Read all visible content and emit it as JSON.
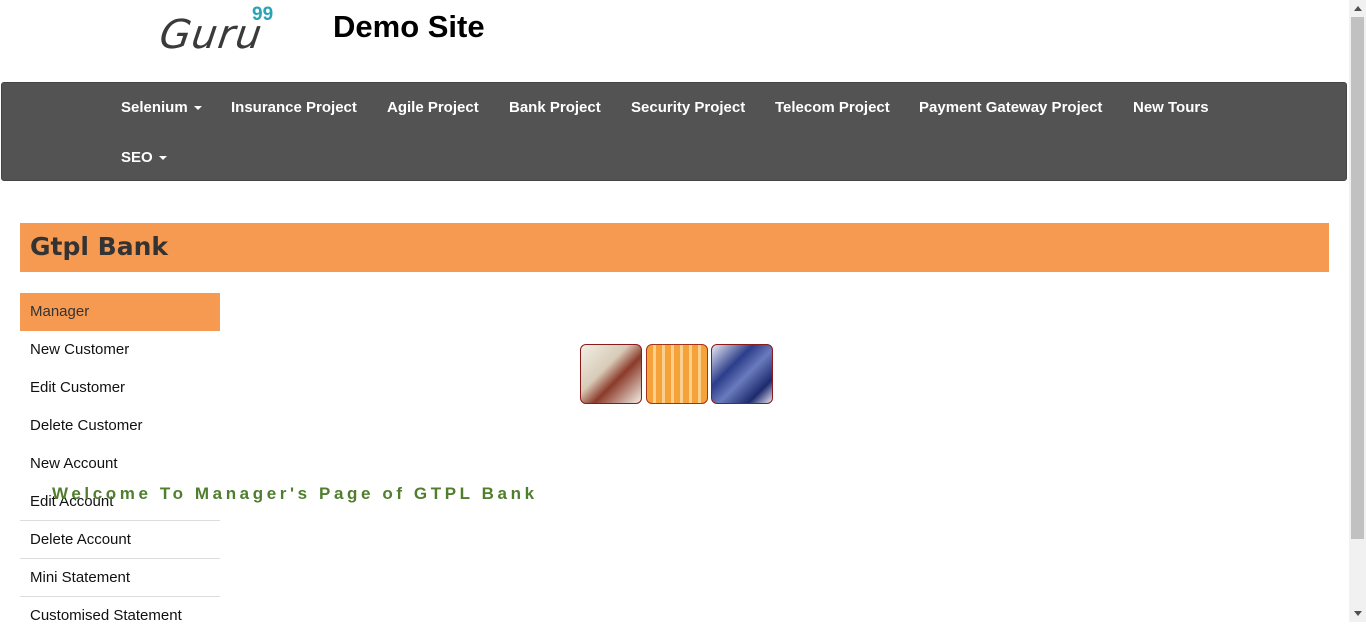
{
  "logo": {
    "text": "Guru",
    "sup": "99"
  },
  "site_title": "Demo Site",
  "nav": {
    "selenium": "Selenium",
    "insurance": "Insurance Project",
    "agile": "Agile Project",
    "bank": "Bank Project",
    "security": "Security Project",
    "telecom": "Telecom Project",
    "payment": "Payment Gateway Project",
    "tours": "New Tours",
    "seo": "SEO"
  },
  "bank": {
    "title": "Gtpl Bank"
  },
  "menu": {
    "items": [
      "Manager",
      "New Customer",
      "Edit Customer",
      "Delete Customer",
      "New Account",
      "Edit Account",
      "Delete Account",
      "Mini Statement",
      "Customised Statement"
    ],
    "active": "Manager"
  },
  "welcome": "Welcome To Manager's Page of GTPL Bank",
  "colors": {
    "nav_bg": "#535353",
    "accent_orange": "#f79a51",
    "welcome_green": "#4f7f2e",
    "logo_sup": "#2aa3b5"
  },
  "icons": {
    "dropdown": "caret-down-icon",
    "scroll_up": "scroll-up-arrow-icon",
    "scroll_down": "scroll-down-arrow-icon"
  }
}
